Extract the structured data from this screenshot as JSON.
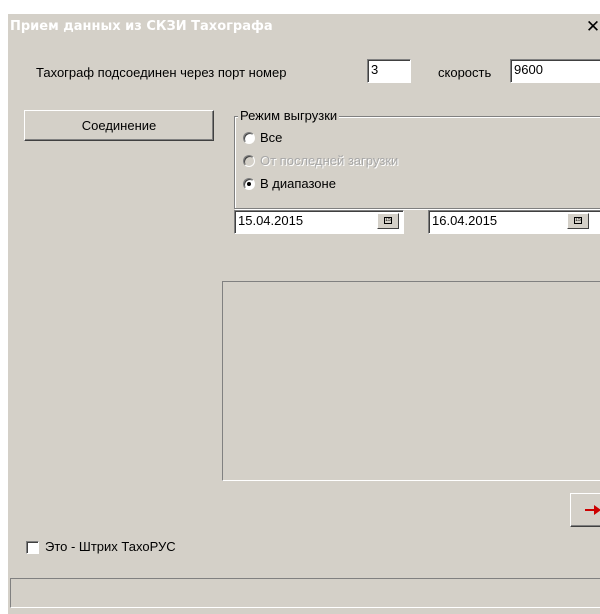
{
  "window": {
    "title": "Прием данных из СКЗИ Тахографа",
    "close_glyph": "✕"
  },
  "connection": {
    "port_label": "Тахограф подсоединен через порт номер",
    "port_value": "3",
    "speed_label": "скорость",
    "speed_value": "9600",
    "connect_button": "Соединение"
  },
  "export_mode": {
    "legend": "Режим выгрузки",
    "options": [
      {
        "label": "Все",
        "selected": false,
        "enabled": true
      },
      {
        "label": "От последней загрузки",
        "selected": false,
        "enabled": false
      },
      {
        "label": "В диапазоне",
        "selected": true,
        "enabled": true
      }
    ]
  },
  "date_range": {
    "from": "15.04.2015",
    "to": "16.04.2015",
    "calendar_icon_text": "15"
  },
  "options": {
    "shtrikh_checkbox_label": "Это - Штрих ТахоРУС",
    "shtrikh_checked": false
  },
  "icons": {
    "next_arrow": "arrow-right-icon",
    "arrow_color": "#cc0000"
  }
}
